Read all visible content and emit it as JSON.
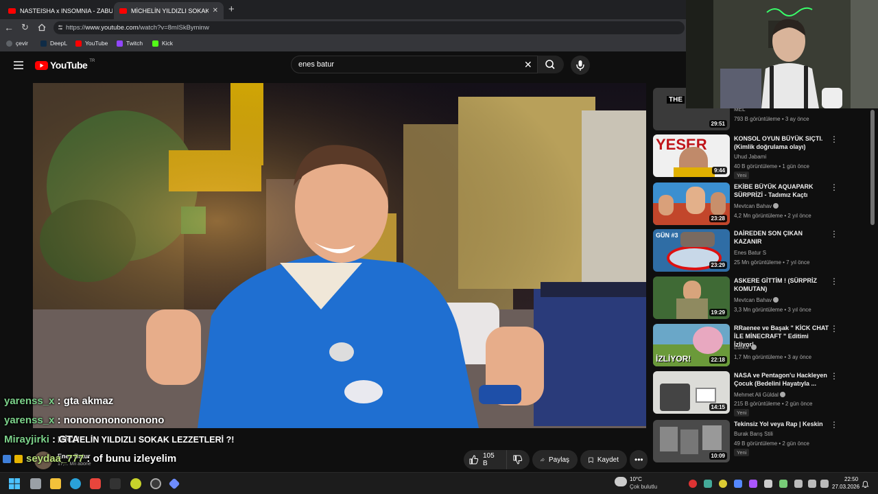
{
  "browser": {
    "tabs": [
      {
        "label": "NASTEISHA x INSOMNIA - ZABUTI"
      },
      {
        "label": "MİCHELİN YILDIZLI SOKAK LEZZETLE"
      }
    ],
    "url_prefix": "https://",
    "url_domain": "www.youtube.com",
    "url_path": "/watch?v=8mISkByminw",
    "bookmarks": [
      {
        "label": "çevir"
      },
      {
        "label": "DeepL"
      },
      {
        "label": "YouTube"
      },
      {
        "label": "Twitch"
      },
      {
        "label": "Kick"
      }
    ]
  },
  "youtube": {
    "logo": "YouTube",
    "region": "TR",
    "search_value": "enes batur"
  },
  "video": {
    "title": "MİCHELİN YILDIZLI SOKAK LEZZETLERİ ?!",
    "channel": "Enes Batur",
    "subs": "17,... Mn abone",
    "like_count": "105 B",
    "share_label": "Paylaş",
    "save_label": "Kaydet"
  },
  "chat": [
    {
      "user": "yarenss_x",
      "sep": " : ",
      "text": "gta akmaz"
    },
    {
      "user": "yarenss_x",
      "sep": " : ",
      "text": "nononononononono"
    },
    {
      "user": "Mirayjirki",
      "sep": " : ",
      "text": "GTA"
    },
    {
      "user": "seydaa_777",
      "sep": " : ",
      "text": "of bunu izleyelim"
    }
  ],
  "recommendations": [
    {
      "title": "",
      "channel": "MEL",
      "meta": "793 B görüntüleme • 3 ay önce",
      "duration": "29:51",
      "new": ""
    },
    {
      "title": "KONSOL OYUN BÜYÜK SIÇTI. (Kimlik doğrulama olayı)",
      "channel": "Uhud Jabami",
      "meta": "40 B görüntüleme • 1 gün önce",
      "duration": "9:44",
      "new": "Yeni"
    },
    {
      "title": "EKİBE BÜYÜK AQUAPARK SÜRPRİZİ - Tadımız Kaçtı",
      "channel": "Mevtcan Bahav",
      "meta": "4,2 Mn görüntüleme • 2 yıl önce",
      "duration": "23:28",
      "new": ""
    },
    {
      "title": "DAİREDEN SON ÇIKAN KAZANIR",
      "channel": "Enes Batur S",
      "meta": "25 Mn görüntüleme • 7 yıl önce",
      "duration": "23:29",
      "new": ""
    },
    {
      "title": "ASKERE GİTTİM ! (SÜRPRİZ KOMUTAN)",
      "channel": "Mevtcan Bahav",
      "meta": "3,3 Mn görüntüleme • 3 yıl önce",
      "duration": "19:29",
      "new": ""
    },
    {
      "title": "RRaenee ve Başak \" KİCK CHAT İLE MİNECRAFT \" Editimi İzliyor!",
      "channel": "Edixor",
      "meta": "1,7 Mn görüntüleme • 3 ay önce",
      "duration": "22:18",
      "new": ""
    },
    {
      "title": "NASA ve Pentagon'u Hackleyen Çocuk (Bedelini Hayatıyla ...",
      "channel": "Mehmet Ali Güldal",
      "meta": "215 B görüntüleme • 2 gün önce",
      "duration": "14:15",
      "new": "Yeni"
    },
    {
      "title": "Tekinsiz Yol veya Rap | Keskin",
      "channel": "Burak Barış Stili",
      "meta": "49 B görüntüleme • 2 gün önce",
      "duration": "10:09",
      "new": "Yeni"
    }
  ],
  "taskbar": {
    "temp": "10°C",
    "weather": "Çok bulutlu",
    "time": "22:50",
    "date": "27.03.2026"
  },
  "colors": {
    "accent": "#ff0000",
    "chat_user": "#7cd28a",
    "bg": "#0f0f0f"
  }
}
